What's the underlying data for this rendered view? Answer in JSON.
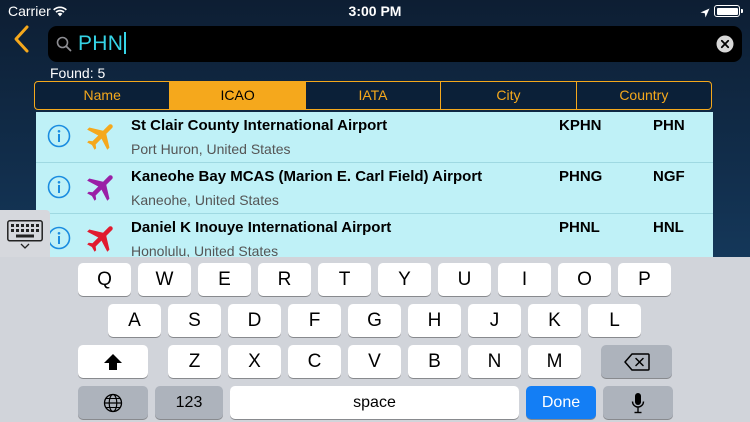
{
  "status_bar": {
    "carrier": "Carrier",
    "time": "3:00 PM"
  },
  "search": {
    "query": "PHN"
  },
  "found_label": "Found: 5",
  "segments": [
    {
      "label": "Name",
      "active": false
    },
    {
      "label": "ICAO",
      "active": true
    },
    {
      "label": "IATA",
      "active": false
    },
    {
      "label": "City",
      "active": false
    },
    {
      "label": "Country",
      "active": false
    }
  ],
  "results": [
    {
      "name": "St Clair County International Airport",
      "location": "Port Huron, United States",
      "icao": "KPHN",
      "iata": "PHN",
      "plane_color": "#f5a81c"
    },
    {
      "name": "Kaneohe Bay MCAS (Marion E. Carl Field) Airport",
      "location": "Kaneohe, United States",
      "icao": "PHNG",
      "iata": "NGF",
      "plane_color": "#9a1fa6"
    },
    {
      "name": "Daniel K Inouye International Airport",
      "location": "Honolulu, United States",
      "icao": "PHNL",
      "iata": "HNL",
      "plane_color": "#e11b2f"
    }
  ],
  "keyboard": {
    "row1": [
      "Q",
      "W",
      "E",
      "R",
      "T",
      "Y",
      "U",
      "I",
      "O",
      "P"
    ],
    "row2": [
      "A",
      "S",
      "D",
      "F",
      "G",
      "H",
      "J",
      "K",
      "L"
    ],
    "row3": [
      "Z",
      "X",
      "C",
      "V",
      "B",
      "N",
      "M"
    ],
    "numbers_label": "123",
    "space_label": "space",
    "done_label": "Done"
  },
  "colors": {
    "accent": "#f5a81c",
    "query_text": "#35d4e6",
    "list_background": "#bff1f7",
    "info": "#1a8ce0",
    "done_key": "#137ef5"
  },
  "icons": [
    "wifi-icon",
    "location-arrow-icon",
    "battery-icon",
    "back-chevron-icon",
    "search-icon",
    "clear-icon",
    "info-icon",
    "airplane-icon",
    "keyboard-dismiss-icon",
    "shift-icon",
    "backspace-icon",
    "globe-icon",
    "microphone-icon"
  ]
}
